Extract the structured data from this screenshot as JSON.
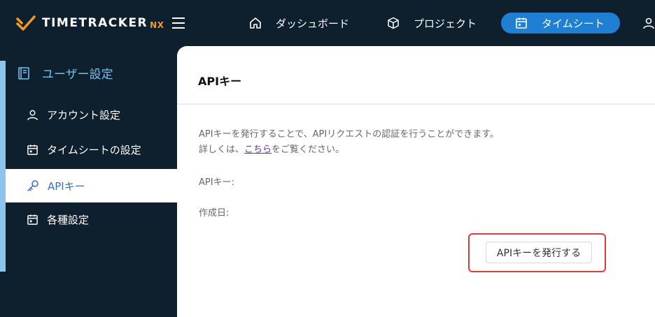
{
  "app": {
    "logo_text": "TIMETRACKER",
    "logo_suffix": "NX"
  },
  "nav": {
    "items": [
      {
        "label": "ダッシュボード",
        "icon": "home-icon"
      },
      {
        "label": "プロジェクト",
        "icon": "cube-icon"
      },
      {
        "label": "タイムシート",
        "icon": "calendar-icon",
        "active": true
      }
    ],
    "user_icon": "user-icon"
  },
  "sidebar": {
    "header": "ユーザー設定",
    "items": [
      {
        "label": "アカウント設定",
        "icon": "user-icon"
      },
      {
        "label": "タイムシートの設定",
        "icon": "calendar-icon"
      },
      {
        "label": "APIキー",
        "icon": "key-icon",
        "active": true
      },
      {
        "label": "各種設定",
        "icon": "calendar-icon"
      }
    ]
  },
  "main": {
    "title": "APIキー",
    "description_line1": "APIキーを発行することで、APIリクエストの認証を行うことができます。",
    "description_line2_prefix": "詳しくは、",
    "description_link": "こちら",
    "description_line2_suffix": "をご覧ください。",
    "api_key_label": "APIキー:",
    "created_label": "作成日:",
    "issue_button": "APIキーを発行する"
  },
  "colors": {
    "nav_bg": "#0e1f2e",
    "accent": "#1e7fd3",
    "logo_orange": "#f09b22",
    "highlight": "#e03a3a"
  }
}
